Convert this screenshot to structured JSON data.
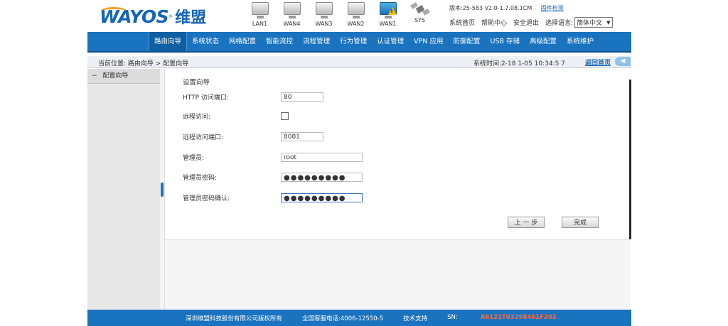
{
  "brand": {
    "latin": "WAYOS",
    "reg": "®",
    "cn": "维盟"
  },
  "ports": [
    {
      "label": "LAN1",
      "state": "idle"
    },
    {
      "label": "WAN4",
      "state": "idle"
    },
    {
      "label": "WAN3",
      "state": "idle"
    },
    {
      "label": "WAN2",
      "state": "idle"
    },
    {
      "label": "WAN1",
      "state": "warning"
    },
    {
      "label": "SYS",
      "state": "system"
    }
  ],
  "version": {
    "text": "版本:25-583 V2.0-1.7.08.1CM",
    "link": "固件检测"
  },
  "toplinks": {
    "home": "系统首页",
    "help": "帮助中心",
    "logout": "安全退出",
    "lang_label": "选择语言:",
    "lang_value": "简体中文"
  },
  "nav": [
    {
      "label": "路由向导",
      "active": true
    },
    {
      "label": "系统状态"
    },
    {
      "label": "网络配置"
    },
    {
      "label": "智能流控"
    },
    {
      "label": "流程管理"
    },
    {
      "label": "行为管理"
    },
    {
      "label": "认证管理"
    },
    {
      "label": "VPN 应用"
    },
    {
      "label": "防御配置"
    },
    {
      "label": "USB 存储"
    },
    {
      "label": "高级配置"
    },
    {
      "label": "系统维护"
    }
  ],
  "breadcrumb": "当前位置: 路由向导 > 配置向导",
  "system_time": "系统时间:2-18   1-05  10:34:5 7",
  "back_home": "返回首页",
  "sidebar": {
    "item": "配置向导"
  },
  "form": {
    "title": "设置向导",
    "http_port_label": "HTTP 访问端口:",
    "http_port_value": "80",
    "remote_label": "远程访问:",
    "remote_port_label": "远程访问端口:",
    "remote_port_value": "8081",
    "admin_label": "管理员:",
    "admin_value": "root",
    "pwd_label": "管理员密码:",
    "pwd_value": "●●●●●●●●●",
    "pwd_confirm_label": "管理员密码确认:",
    "pwd_confirm_value": "●●●●●●●●●",
    "prev_button": "上 一 步",
    "finish_button": "完成"
  },
  "footer": {
    "copyright": "深圳维盟科技股份有限公司版权所有",
    "hotline": "全国客服电话:4006-12550-5",
    "support": "技术支持",
    "sn_label": "SN:",
    "sn_value": "A6121T03298461F203"
  }
}
